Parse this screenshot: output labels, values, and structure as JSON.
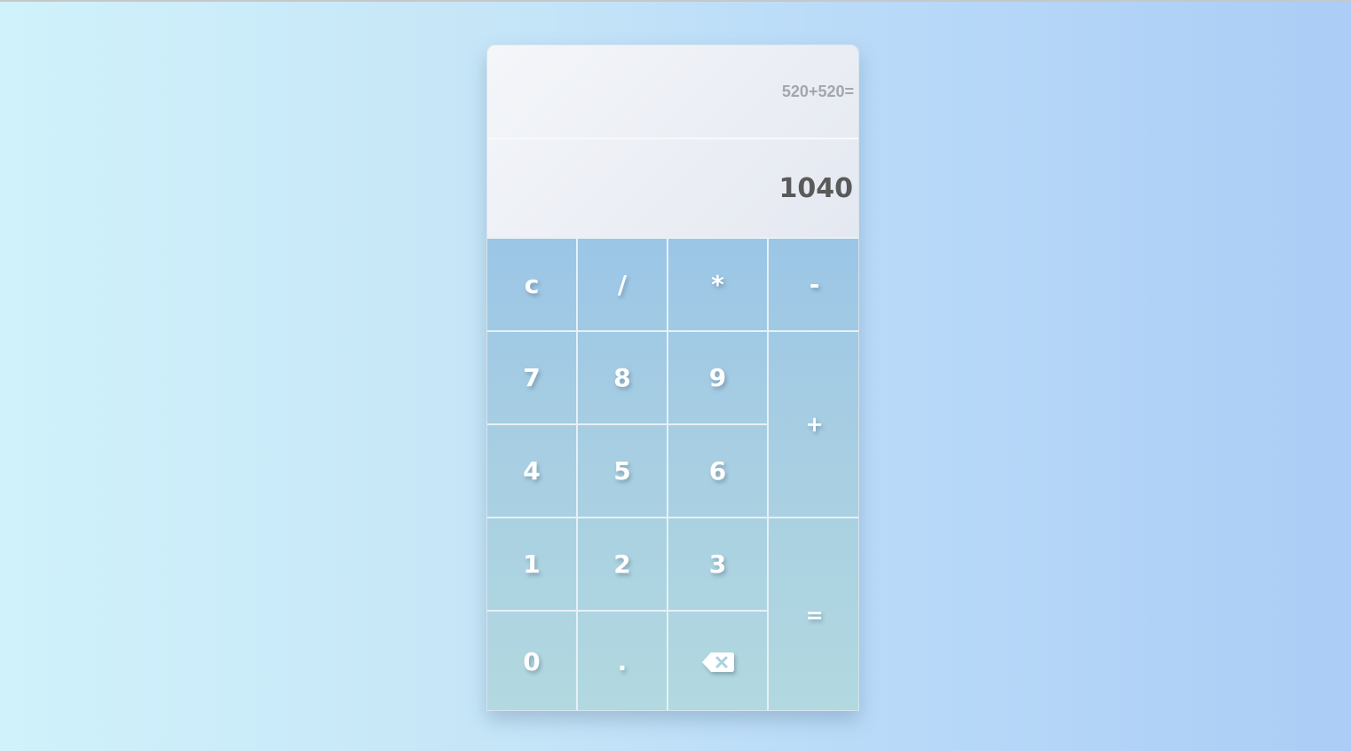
{
  "display": {
    "expression": "520+520=",
    "result": "1040"
  },
  "keys": {
    "clear": "c",
    "divide": "/",
    "multiply": "*",
    "subtract": "-",
    "seven": "7",
    "eight": "8",
    "nine": "9",
    "add": "+",
    "four": "4",
    "five": "5",
    "six": "6",
    "one": "1",
    "two": "2",
    "three": "3",
    "equals": "=",
    "zero": "0",
    "decimal": ".",
    "backspace_icon": "backspace-icon"
  },
  "colors": {
    "keypad_top": "#9bc6e6",
    "keypad_bottom": "#b2d9e0",
    "display_bg": "#eef1f6",
    "result_text": "#5a5a5a",
    "expression_text": "#a3a6ac"
  }
}
